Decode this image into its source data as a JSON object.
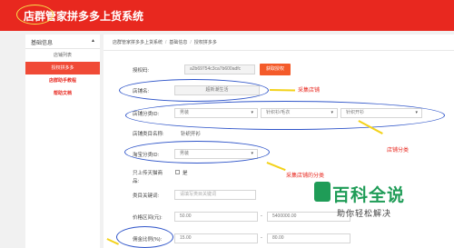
{
  "header": {
    "brand": "店群管家拼多多上货系统"
  },
  "sidebar": {
    "section_title": "基础信息",
    "collapse_arrow": "▲",
    "items": [
      {
        "label": "店铺列表"
      },
      {
        "label": "授权拼多多"
      },
      {
        "label": "店群助手教程"
      },
      {
        "label": "帮助文档"
      }
    ]
  },
  "breadcrumb": {
    "items": [
      "店群管家拼多多上货系统",
      "基础信息",
      "授权拼多多"
    ],
    "separator": "/"
  },
  "form": {
    "auth_code": {
      "label": "授权码:",
      "value": "a2b69754c3ca7b600adfc"
    },
    "get_auth_button": "获取授权",
    "store_name": {
      "label": "店铺名:",
      "value": "超新潮生活"
    },
    "store_category": {
      "label": "店铺分类ID:",
      "values": [
        "男装",
        "针织衫/毛衣",
        "针织开衫"
      ]
    },
    "store_category_name": {
      "label": "店铺类目名称:",
      "value": "针织开衫"
    },
    "taobao_category": {
      "label": "淘宝分类ID:",
      "value": "男装"
    },
    "tmall_only": {
      "label_line1": "只上传天猫商",
      "label_line2": "品:",
      "option": "是"
    },
    "keyword": {
      "label": "类目关键词:",
      "placeholder": "请填写类目关键词"
    },
    "price_range": {
      "label": "价格区间(元):",
      "min": "50.00",
      "max": "5400000.00",
      "dash": "-"
    },
    "commission": {
      "label": "佣金比例(%):",
      "min": "15.00",
      "max": "80.00",
      "dash": "-"
    }
  },
  "annotations": {
    "collect_store": "采集店铺",
    "store_category": "店铺分类",
    "collect_category": "采集店铺的分类"
  },
  "watermark": {
    "title": "百科全说",
    "subtitle": "助你轻松解决"
  },
  "colors": {
    "header_red": "#e8281f",
    "ring_blue": "#2f55c9",
    "arrow_yellow": "#f3d21a",
    "button_orange": "#f45b2a",
    "watermark_green": "#1f9c57"
  }
}
